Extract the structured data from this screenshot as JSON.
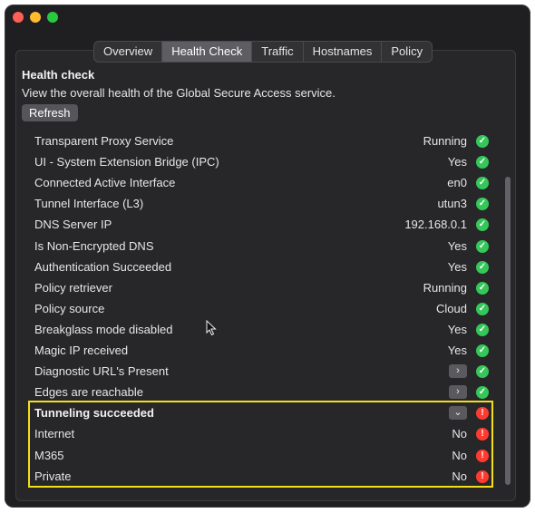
{
  "tabs": [
    {
      "label": "Overview"
    },
    {
      "label": "Health Check"
    },
    {
      "label": "Traffic"
    },
    {
      "label": "Hostnames"
    },
    {
      "label": "Policy"
    }
  ],
  "section": {
    "title": "Health check",
    "description": "View the overall health of the Global Secure Access service.",
    "refresh_label": "Refresh"
  },
  "rows": [
    {
      "label": "Transparent Proxy Service",
      "value": "Running",
      "status": "ok"
    },
    {
      "label": "UI - System Extension Bridge (IPC)",
      "value": "Yes",
      "status": "ok"
    },
    {
      "label": "Connected Active Interface",
      "value": "en0",
      "status": "ok"
    },
    {
      "label": "Tunnel Interface (L3)",
      "value": "utun3",
      "status": "ok"
    },
    {
      "label": "DNS Server IP",
      "value": "192.168.0.1",
      "status": "ok"
    },
    {
      "label": "Is Non-Encrypted DNS",
      "value": "Yes",
      "status": "ok"
    },
    {
      "label": "Authentication Succeeded",
      "value": "Yes",
      "status": "ok"
    },
    {
      "label": "Policy retriever",
      "value": "Running",
      "status": "ok"
    },
    {
      "label": "Policy source",
      "value": "Cloud",
      "status": "ok"
    },
    {
      "label": "Breakglass mode disabled",
      "value": "Yes",
      "status": "ok"
    },
    {
      "label": "Magic IP received",
      "value": "Yes",
      "status": "ok"
    },
    {
      "label": "Diagnostic URL's Present",
      "expander": "collapsed",
      "status": "ok"
    },
    {
      "label": "Edges are reachable",
      "expander": "collapsed",
      "status": "ok"
    },
    {
      "label": "Tunneling succeeded",
      "expander": "expanded",
      "status": "error",
      "bold": true
    },
    {
      "label": "Internet",
      "value": "No",
      "status": "error"
    },
    {
      "label": "M365",
      "value": "No",
      "status": "error"
    },
    {
      "label": "Private",
      "value": "No",
      "status": "error"
    }
  ],
  "icons": {
    "ok": "checkmark-circle-icon",
    "error": "exclamation-circle-icon",
    "expander_collapsed": "chevron-right-icon",
    "expander_expanded": "chevron-down-icon"
  },
  "colors": {
    "ok": "#34c759",
    "error": "#ff3b30",
    "highlight": "#f3de1c"
  }
}
